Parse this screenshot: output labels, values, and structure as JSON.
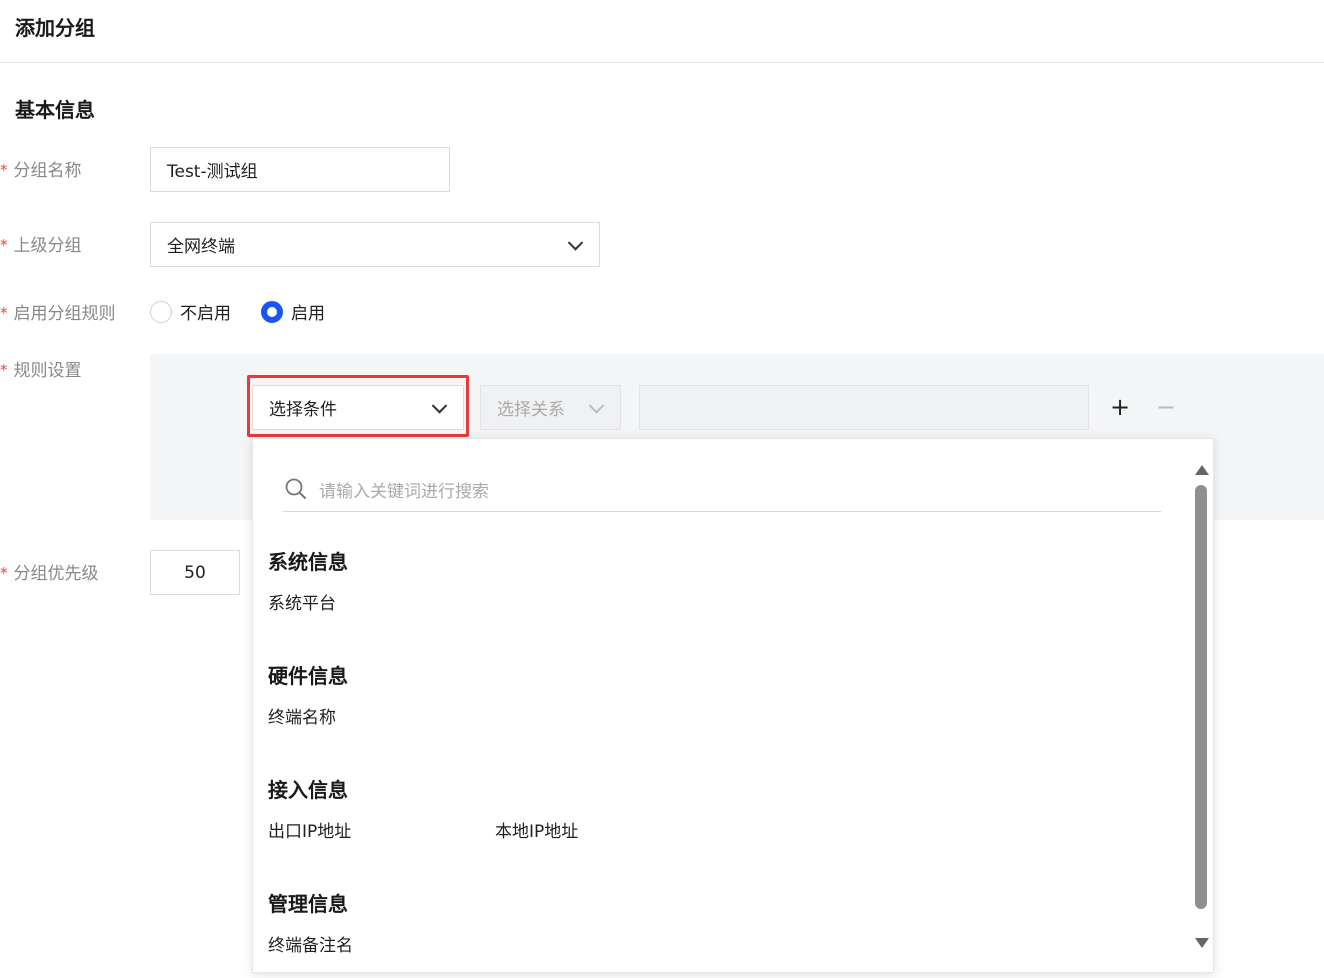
{
  "page": {
    "title": "添加分组"
  },
  "section": {
    "title": "基本信息"
  },
  "required_mark": "*",
  "form": {
    "group_name": {
      "label": "分组名称",
      "value": "Test-测试组"
    },
    "parent_group": {
      "label": "上级分组",
      "value": "全网终端"
    },
    "enable_rules": {
      "label": "启用分组规则",
      "options": [
        "不启用",
        "启用"
      ],
      "selected": "启用"
    },
    "rule_settings": {
      "label": "规则设置",
      "condition_select": "选择条件",
      "relation_select": "选择关系",
      "value_input": "",
      "add_symbol": "+",
      "remove_symbol": "−"
    },
    "priority": {
      "label": "分组优先级",
      "value": "50"
    }
  },
  "dropdown": {
    "search_placeholder": "请输入关键词进行搜索",
    "groups": [
      {
        "title": "系统信息",
        "items": [
          "系统平台"
        ]
      },
      {
        "title": "硬件信息",
        "items": [
          "终端名称"
        ]
      },
      {
        "title": "接入信息",
        "items": [
          "出口IP地址",
          "本地IP地址"
        ]
      },
      {
        "title": "管理信息",
        "items": [
          "终端备注名"
        ]
      }
    ]
  },
  "colors": {
    "accent": "#1a55f0",
    "required": "#e54545",
    "highlight": "#e93a3a"
  }
}
